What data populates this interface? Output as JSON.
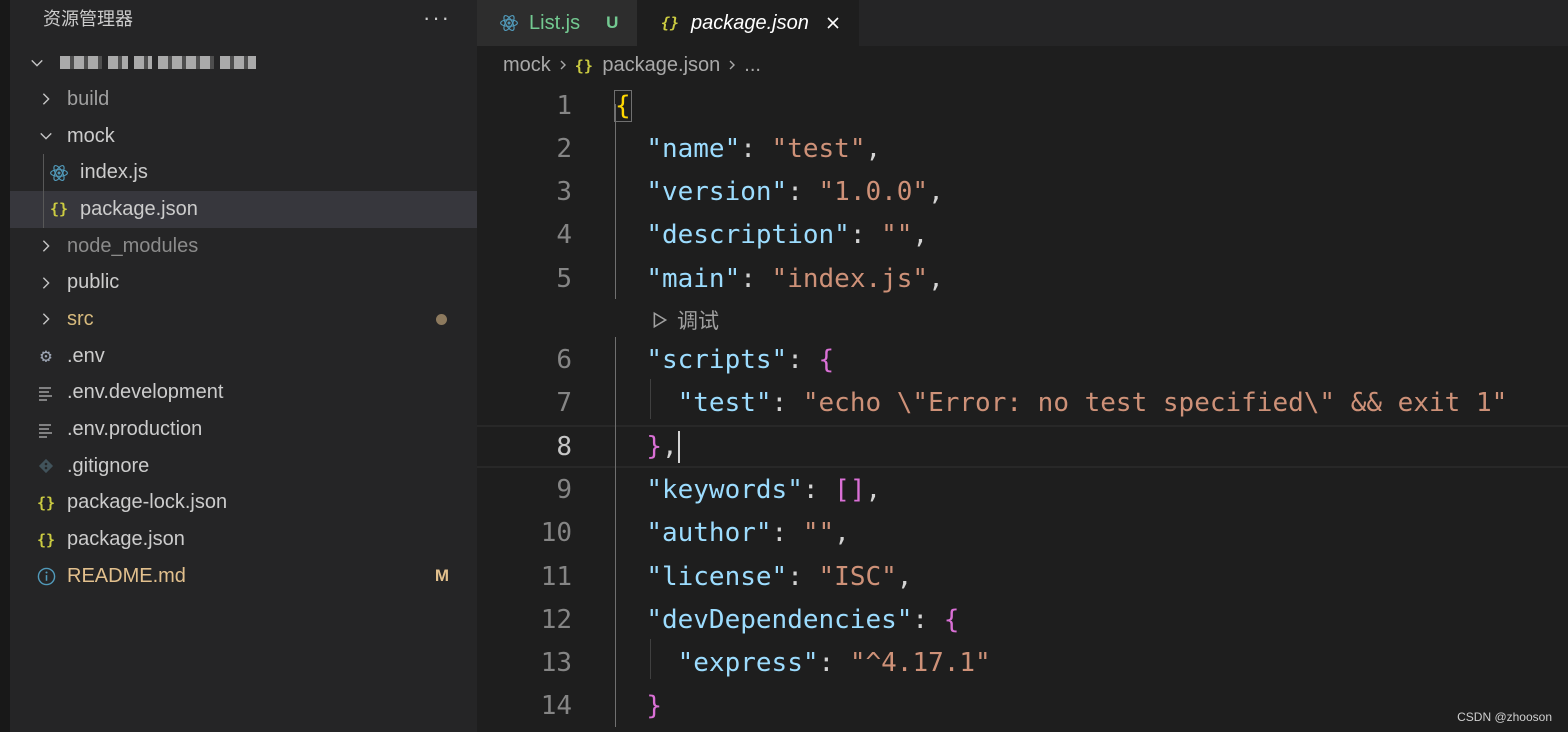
{
  "sidebar": {
    "title": "资源管理器",
    "more_actions_label": "···",
    "tree": [
      {
        "label": "build",
        "type": "folder",
        "expanded": false,
        "color": "#a0a0a0"
      },
      {
        "label": "mock",
        "type": "folder",
        "expanded": true,
        "color": "#cccccc"
      },
      {
        "label": "index.js",
        "type": "file",
        "icon": "react-icon",
        "color": "#cccccc"
      },
      {
        "label": "package.json",
        "type": "file",
        "icon": "json-braces-icon",
        "color": "#cccccc",
        "selected": true
      },
      {
        "label": "node_modules",
        "type": "folder",
        "expanded": false,
        "color": "#8b8b8b"
      },
      {
        "label": "public",
        "type": "folder",
        "expanded": false,
        "color": "#cccccc"
      },
      {
        "label": "src",
        "type": "folder",
        "expanded": false,
        "color": "#d7ba7d",
        "badge": "dot"
      },
      {
        "label": ".env",
        "type": "file",
        "icon": "gear-icon",
        "color": "#cccccc"
      },
      {
        "label": ".env.development",
        "type": "file",
        "icon": "lines-icon",
        "color": "#cccccc"
      },
      {
        "label": ".env.production",
        "type": "file",
        "icon": "lines-icon",
        "color": "#cccccc"
      },
      {
        "label": ".gitignore",
        "type": "file",
        "icon": "git-icon",
        "color": "#cccccc"
      },
      {
        "label": "package-lock.json",
        "type": "file",
        "icon": "json-braces-icon",
        "color": "#cccccc"
      },
      {
        "label": "package.json",
        "type": "file",
        "icon": "json-braces-icon",
        "color": "#cccccc"
      },
      {
        "label": "README.md",
        "type": "file",
        "icon": "info-icon",
        "color": "#e2c08d",
        "badge": "M"
      }
    ]
  },
  "tabs": [
    {
      "label": "List.js",
      "status": "U",
      "active": false,
      "icon": "react-icon"
    },
    {
      "label": "package.json",
      "active": true,
      "icon": "json-braces-icon"
    }
  ],
  "breadcrumb": {
    "items": [
      "mock",
      "package.json",
      "..."
    ]
  },
  "icon_glyphs": {
    "json_braces": "{}",
    "gear": "⚙"
  },
  "codelens": {
    "label": "调试"
  },
  "code": [
    {
      "n": "1",
      "tokens": [
        [
          "brace1",
          "{"
        ]
      ]
    },
    {
      "n": "2",
      "tokens": [
        [
          "punc",
          "  "
        ],
        [
          "key",
          "\"name\""
        ],
        [
          "punc",
          ": "
        ],
        [
          "str",
          "\"test\""
        ],
        [
          "punc",
          ","
        ]
      ]
    },
    {
      "n": "3",
      "tokens": [
        [
          "punc",
          "  "
        ],
        [
          "key",
          "\"version\""
        ],
        [
          "punc",
          ": "
        ],
        [
          "str",
          "\"1.0.0\""
        ],
        [
          "punc",
          ","
        ]
      ]
    },
    {
      "n": "4",
      "tokens": [
        [
          "punc",
          "  "
        ],
        [
          "key",
          "\"description\""
        ],
        [
          "punc",
          ": "
        ],
        [
          "str",
          "\"\""
        ],
        [
          "punc",
          ","
        ]
      ]
    },
    {
      "n": "5",
      "tokens": [
        [
          "punc",
          "  "
        ],
        [
          "key",
          "\"main\""
        ],
        [
          "punc",
          ": "
        ],
        [
          "str",
          "\"index.js\""
        ],
        [
          "punc",
          ","
        ]
      ]
    },
    {
      "n": "6",
      "tokens": [
        [
          "punc",
          "  "
        ],
        [
          "key",
          "\"scripts\""
        ],
        [
          "punc",
          ": "
        ],
        [
          "brace2",
          "{"
        ]
      ]
    },
    {
      "n": "7",
      "tokens": [
        [
          "punc",
          "    "
        ],
        [
          "key",
          "\"test\""
        ],
        [
          "punc",
          ": "
        ],
        [
          "str",
          "\"echo \\\"Error: no test specified\\\" && exit 1\""
        ]
      ]
    },
    {
      "n": "8",
      "tokens": [
        [
          "punc",
          "  "
        ],
        [
          "brace2",
          "}"
        ],
        [
          "punc",
          ","
        ]
      ],
      "current": true
    },
    {
      "n": "9",
      "tokens": [
        [
          "punc",
          "  "
        ],
        [
          "key",
          "\"keywords\""
        ],
        [
          "punc",
          ": "
        ],
        [
          "brace2",
          "[]"
        ],
        [
          "punc",
          ","
        ]
      ]
    },
    {
      "n": "10",
      "tokens": [
        [
          "punc",
          "  "
        ],
        [
          "key",
          "\"author\""
        ],
        [
          "punc",
          ": "
        ],
        [
          "str",
          "\"\""
        ],
        [
          "punc",
          ","
        ]
      ]
    },
    {
      "n": "11",
      "tokens": [
        [
          "punc",
          "  "
        ],
        [
          "key",
          "\"license\""
        ],
        [
          "punc",
          ": "
        ],
        [
          "str",
          "\"ISC\""
        ],
        [
          "punc",
          ","
        ]
      ]
    },
    {
      "n": "12",
      "tokens": [
        [
          "punc",
          "  "
        ],
        [
          "key",
          "\"devDependencies\""
        ],
        [
          "punc",
          ": "
        ],
        [
          "brace2",
          "{"
        ]
      ]
    },
    {
      "n": "13",
      "tokens": [
        [
          "punc",
          "    "
        ],
        [
          "key",
          "\"express\""
        ],
        [
          "punc",
          ": "
        ],
        [
          "str",
          "\"^4.17.1\""
        ]
      ]
    },
    {
      "n": "14",
      "tokens": [
        [
          "punc",
          "  "
        ],
        [
          "brace2",
          "}"
        ]
      ]
    }
  ],
  "watermark": "CSDN @zhooson"
}
